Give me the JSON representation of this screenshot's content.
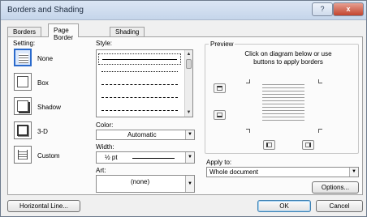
{
  "window": {
    "title": "Borders and Shading",
    "help_label": "?",
    "close_label": "x"
  },
  "tabs": [
    {
      "label": "Borders"
    },
    {
      "label": "Page Border"
    },
    {
      "label": "Shading"
    }
  ],
  "setting": {
    "heading": "Setting:",
    "options": [
      {
        "label": "None",
        "selected": true
      },
      {
        "label": "Box"
      },
      {
        "label": "Shadow"
      },
      {
        "label": "3-D"
      },
      {
        "label": "Custom"
      }
    ]
  },
  "style": {
    "heading": "Style:"
  },
  "color": {
    "heading": "Color:",
    "value": "Automatic"
  },
  "width": {
    "heading": "Width:",
    "value": "½ pt"
  },
  "art": {
    "heading": "Art:",
    "value": "(none)"
  },
  "preview": {
    "heading": "Preview",
    "hint_line1": "Click on diagram below or use",
    "hint_line2": "buttons to apply borders"
  },
  "apply_to": {
    "heading": "Apply to:",
    "value": "Whole document"
  },
  "buttons": {
    "options": "Options...",
    "horizontal_line": "Horizontal Line...",
    "ok": "OK",
    "cancel": "Cancel"
  },
  "colors": {
    "titlebar": "#c5d5ea",
    "selection": "#2a6acc",
    "close": "#c2442e"
  }
}
